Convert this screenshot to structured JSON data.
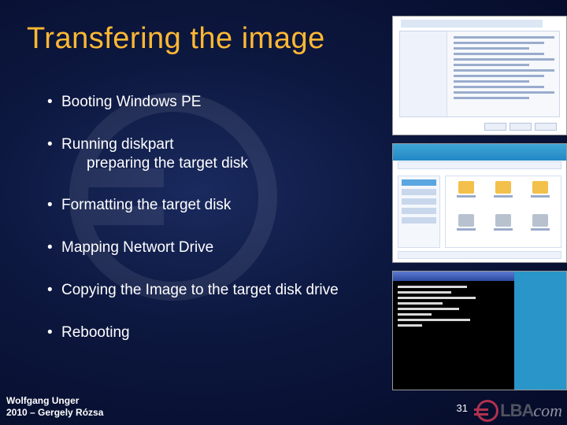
{
  "title": "Transfering the image",
  "bullets": [
    {
      "text": "Booting Windows PE"
    },
    {
      "text": "Running diskpart",
      "sub": "preparing the target disk"
    },
    {
      "text": "Formatting the target disk"
    },
    {
      "text": "Mapping Networt Drive"
    },
    {
      "text": "Copying the Image to the target disk drive"
    },
    {
      "text": "Rebooting"
    }
  ],
  "footer": {
    "line1": "Wolfgang Unger",
    "line2": "2010 – Gergely Rózsa"
  },
  "page_number": "31",
  "logo": {
    "text1": "LBA",
    "text2": "com"
  },
  "thumbnails": [
    {
      "name": "winpe-setup-screenshot"
    },
    {
      "name": "explorer-window-screenshot"
    },
    {
      "name": "command-prompt-screenshot"
    }
  ],
  "colors": {
    "title": "#ffb833",
    "accent": "#b0314e"
  }
}
